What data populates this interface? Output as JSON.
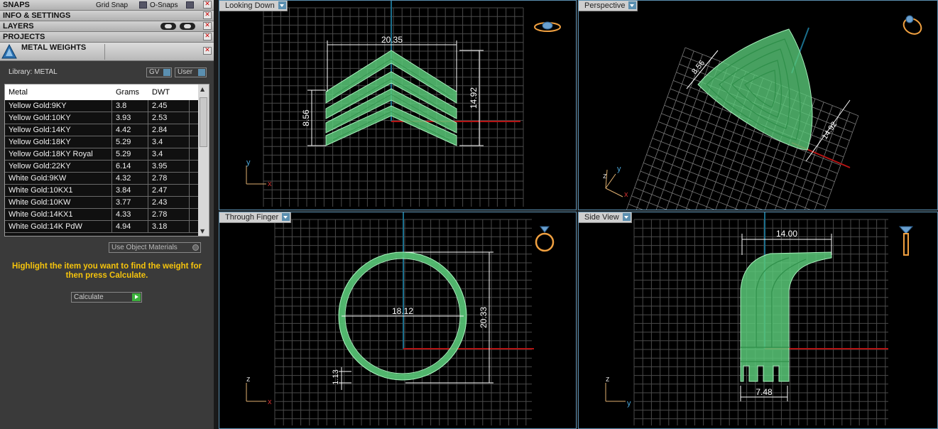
{
  "panel": {
    "snaps_label": "SNAPS",
    "grid_snap_label": "Grid Snap",
    "osnaps_label": "O-Snaps",
    "info_label": "INFO & SETTINGS",
    "layers_label": "LAYERS",
    "projects_label": "PROJECTS",
    "metal_weights_label": "METAL WEIGHTS",
    "library_label": "Library: METAL",
    "gv_label": "GV",
    "user_label": "User",
    "table": {
      "headers": [
        "Metal",
        "Grams",
        "DWT"
      ],
      "rows": [
        [
          "Yellow Gold:9KY",
          "3.8",
          "2.45"
        ],
        [
          "Yellow Gold:10KY",
          "3.93",
          "2.53"
        ],
        [
          "Yellow Gold:14KY",
          "4.42",
          "2.84"
        ],
        [
          "Yellow Gold:18KY",
          "5.29",
          "3.4"
        ],
        [
          "Yellow Gold:18KY Royal",
          "5.29",
          "3.4"
        ],
        [
          "Yellow Gold:22KY",
          "6.14",
          "3.95"
        ],
        [
          "White Gold:9KW",
          "4.32",
          "2.78"
        ],
        [
          "White Gold:10KX1",
          "3.84",
          "2.47"
        ],
        [
          "White Gold:10KW",
          "3.77",
          "2.43"
        ],
        [
          "White Gold:14KX1",
          "4.33",
          "2.78"
        ],
        [
          "White Gold:14K PdW",
          "4.94",
          "3.18"
        ]
      ]
    },
    "use_object_materials": "Use Object Materials",
    "hint": "Highlight the item you want to find the weight for then press Calculate.",
    "calculate_label": "Calculate"
  },
  "viewports": {
    "top": {
      "label": "Looking Down",
      "dims": {
        "width": "20.35",
        "height": "14.92",
        "band": "8.56"
      },
      "axes": {
        "v": "y",
        "h": "x"
      }
    },
    "perspective": {
      "label": "Perspective",
      "dims": {
        "a": "8.56",
        "b": "14.92"
      },
      "axes": {
        "v": "y",
        "h": "x",
        "z": "z"
      }
    },
    "front": {
      "label": "Through Finger",
      "dims": {
        "diameter": "18.12",
        "height": "20.33",
        "thickness": "1.13"
      },
      "axes": {
        "v": "z",
        "h": "x"
      }
    },
    "side": {
      "label": "Side View",
      "dims": {
        "top": "14.00",
        "bottom": "7.48"
      },
      "axes": {
        "v": "z",
        "h": "y"
      }
    }
  },
  "colors": {
    "accent": "#5b8fb0",
    "model": "#5cd17a",
    "hint": "#f6c40c",
    "x_axis": "#b41414",
    "y_axis": "#1a6e8c"
  }
}
